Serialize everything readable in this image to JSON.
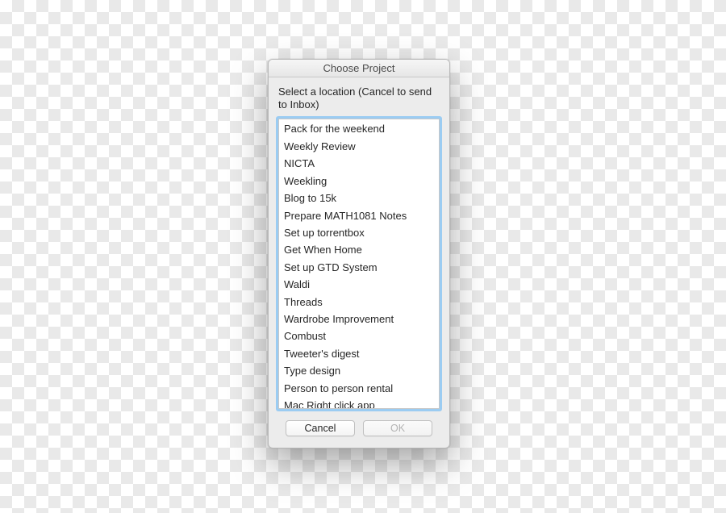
{
  "dialog": {
    "title": "Choose Project",
    "instruction": "Select a location (Cancel to send to Inbox)",
    "items": [
      "Pack for the weekend",
      "Weekly Review",
      "NICTA",
      "Weekling",
      "Blog to 15k",
      "Prepare MATH1081 Notes",
      "Set up torrentbox",
      "Get When Home",
      "Set up GTD System",
      "Waldi",
      "Threads",
      "Wardrobe Improvement",
      "Combust",
      "Tweeter's digest",
      "Type design",
      "Person to person rental",
      "Mac Right click app"
    ],
    "cancel_label": "Cancel",
    "ok_label": "OK"
  }
}
